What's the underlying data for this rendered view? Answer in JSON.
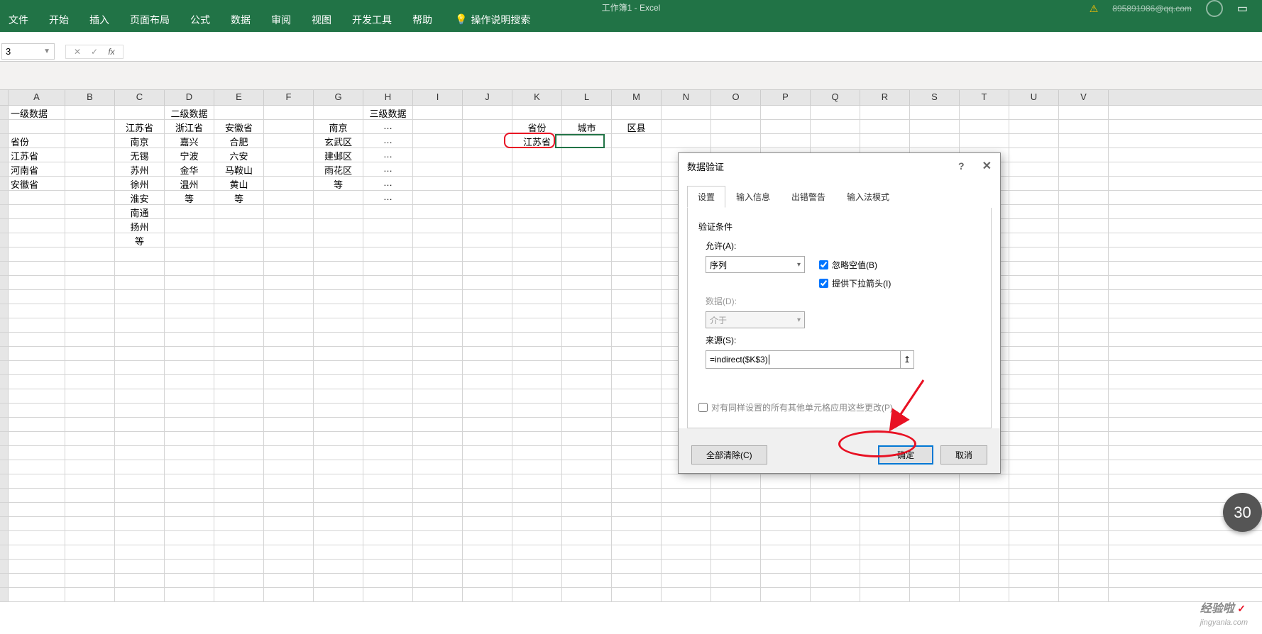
{
  "titlebar": {
    "doc_title": "工作簿1 - Excel",
    "user_email": "895891986@qq.com"
  },
  "ribbon": {
    "tabs": [
      "文件",
      "开始",
      "插入",
      "页面布局",
      "公式",
      "数据",
      "审阅",
      "视图",
      "开发工具",
      "帮助"
    ],
    "search": "操作说明搜索"
  },
  "formula": {
    "name_box": "3",
    "fx_label": "fx"
  },
  "columns": [
    "A",
    "B",
    "C",
    "D",
    "E",
    "F",
    "G",
    "H",
    "I",
    "J",
    "K",
    "L",
    "M",
    "N",
    "O",
    "P",
    "Q",
    "R",
    "S",
    "T",
    "U",
    "V"
  ],
  "sheet": {
    "r1": {
      "A": "一级数据",
      "D": "二级数据",
      "GH": "三级数据"
    },
    "r2": {
      "C": "江苏省",
      "D": "浙江省",
      "E": "安徽省",
      "G": "南京",
      "H": "…",
      "K": "省份",
      "L": "城市",
      "M": "区县"
    },
    "r3": {
      "A": "省份",
      "C": "南京",
      "D": "嘉兴",
      "E": "合肥",
      "G": "玄武区",
      "H": "…",
      "K": "江苏省"
    },
    "r4": {
      "A": "江苏省",
      "C": "无锡",
      "D": "宁波",
      "E": "六安",
      "G": "建邺区",
      "H": "…"
    },
    "r5": {
      "A": "河南省",
      "C": "苏州",
      "D": "金华",
      "E": "马鞍山",
      "G": "雨花区",
      "H": "…"
    },
    "r6": {
      "A": "安徽省",
      "C": "徐州",
      "D": "温州",
      "E": "黄山",
      "G": "等",
      "H": "…"
    },
    "r7": {
      "C": "淮安",
      "D": "等",
      "E": "等",
      "H": "…"
    },
    "r8": {
      "C": "南通"
    },
    "r9": {
      "C": "扬州"
    },
    "r10": {
      "C": "等"
    }
  },
  "dialog": {
    "title": "数据验证",
    "tabs": [
      "设置",
      "输入信息",
      "出错警告",
      "输入法模式"
    ],
    "section_label": "验证条件",
    "allow_label": "允许(A):",
    "allow_value": "序列",
    "data_label": "数据(D):",
    "data_value": "介于",
    "source_label": "来源(S):",
    "source_value": "=indirect($K$3)",
    "check_ignore_blank": "忽略空值(B)",
    "check_dropdown": "提供下拉箭头(I)",
    "check_apply_all": "对有同样设置的所有其他单元格应用这些更改(P)",
    "btn_clear": "全部清除(C)",
    "btn_ok": "确定",
    "btn_cancel": "取消"
  },
  "badge": {
    "num": "30"
  },
  "watermark": {
    "text": "经验啦 ",
    "domain": "jingyanla.com"
  }
}
